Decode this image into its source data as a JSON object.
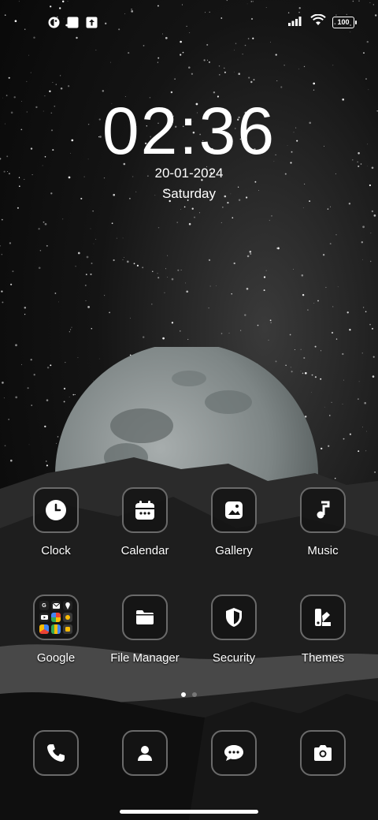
{
  "status_bar": {
    "left_icons": [
      "app-notification-icon",
      "square-notification-icon",
      "upload-notification-icon"
    ],
    "right_icons": [
      "signal-icon",
      "wifi-icon"
    ],
    "battery_level": "100"
  },
  "lock": {
    "time": "02:36",
    "date": "20-01-2024",
    "day": "Saturday"
  },
  "apps": [
    {
      "label": "Clock",
      "icon": "clock-icon"
    },
    {
      "label": "Calendar",
      "icon": "calendar-icon"
    },
    {
      "label": "Gallery",
      "icon": "gallery-icon"
    },
    {
      "label": "Music",
      "icon": "music-icon"
    },
    {
      "label": "Google",
      "icon": "google-folder-icon"
    },
    {
      "label": "File Manager",
      "icon": "folder-icon"
    },
    {
      "label": "Security",
      "icon": "shield-icon"
    },
    {
      "label": "Themes",
      "icon": "themes-icon"
    }
  ],
  "dock": [
    {
      "icon": "phone-icon"
    },
    {
      "icon": "contacts-icon"
    },
    {
      "icon": "messages-icon"
    },
    {
      "icon": "camera-icon"
    }
  ],
  "page_indicator": {
    "total": 2,
    "active": 1
  },
  "colors": {
    "tile_bg": "#141414",
    "tile_border": "#6a6a6a",
    "moon": "#8a9090"
  }
}
